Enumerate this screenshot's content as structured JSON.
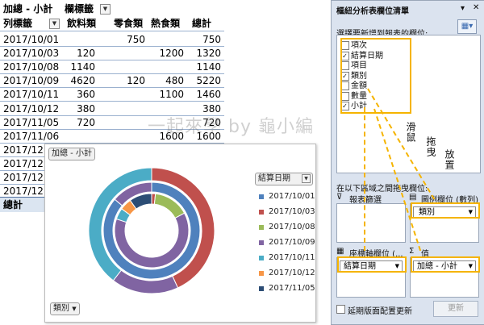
{
  "pivot": {
    "value_chip": "加總 - 小計",
    "col_label": "欄標籤",
    "row_label": "列標籤",
    "columns": [
      "飲料類",
      "零食類",
      "熱食類",
      "總計"
    ],
    "rows": [
      {
        "label": "2017/10/01",
        "c1": "",
        "c2": "750",
        "c3": "",
        "c4": "750"
      },
      {
        "label": "2017/10/03",
        "c1": "120",
        "c2": "",
        "c3": "1200",
        "c4": "1320"
      },
      {
        "label": "2017/10/08",
        "c1": "1140",
        "c2": "",
        "c3": "",
        "c4": "1140"
      },
      {
        "label": "2017/10/09",
        "c1": "4620",
        "c2": "120",
        "c3": "480",
        "c4": "5220"
      },
      {
        "label": "2017/10/11",
        "c1": "360",
        "c2": "",
        "c3": "1100",
        "c4": "1460"
      },
      {
        "label": "2017/10/12",
        "c1": "380",
        "c2": "",
        "c3": "",
        "c4": "380"
      },
      {
        "label": "2017/11/05",
        "c1": "720",
        "c2": "",
        "c3": "",
        "c4": "720"
      },
      {
        "label": "2017/11/06",
        "c1": "",
        "c2": "",
        "c3": "1600",
        "c4": "1600"
      },
      {
        "label": "2017/12",
        "c1": "",
        "c2": "",
        "c3": "",
        "c4": ""
      },
      {
        "label": "2017/12",
        "c1": "",
        "c2": "",
        "c3": "",
        "c4": ""
      },
      {
        "label": "2017/12",
        "c1": "",
        "c2": "",
        "c3": "",
        "c4": ""
      },
      {
        "label": "2017/12",
        "c1": "",
        "c2": "",
        "c3": "",
        "c4": ""
      }
    ],
    "total_label": "總計"
  },
  "watermark": "一起來學 by 龜小編",
  "chart": {
    "value_chip": "加總 - 小計",
    "legend_chip": "結算日期",
    "axis_chip": "類別",
    "legend": [
      {
        "label": "2017/10/01",
        "color": "#4f81bd"
      },
      {
        "label": "2017/10/03",
        "color": "#c0504d"
      },
      {
        "label": "2017/10/08",
        "color": "#9bbb59"
      },
      {
        "label": "2017/10/09",
        "color": "#8064a2"
      },
      {
        "label": "2017/10/11",
        "color": "#4bacc6"
      },
      {
        "label": "2017/10/12",
        "color": "#f79646"
      },
      {
        "label": "2017/11/05",
        "color": "#2c4d75"
      }
    ]
  },
  "panel": {
    "title": "樞紐分析表欄位清單",
    "choose_label": "選擇要新增到報表的欄位:",
    "fields": [
      {
        "label": "項次",
        "checked": false
      },
      {
        "label": "結算日期",
        "checked": true
      },
      {
        "label": "項目",
        "checked": false
      },
      {
        "label": "類別",
        "checked": true
      },
      {
        "label": "金額",
        "checked": false
      },
      {
        "label": "數量",
        "checked": false
      },
      {
        "label": "小計",
        "checked": true
      }
    ],
    "annotations": [
      "滑鼠",
      "拖曳",
      "放置"
    ],
    "drag_label": "在以下區域之間拖曳欄位:",
    "filter_area": "報表篩選",
    "legend_area": "圖例欄位 (數列)",
    "legend_item": "類別",
    "axis_area": "座標軸欄位 (...",
    "axis_item": "結算日期",
    "values_area": "值",
    "values_item": "加總 - 小計",
    "defer_label": "延期版面配置更新",
    "update_button": "更新"
  }
}
